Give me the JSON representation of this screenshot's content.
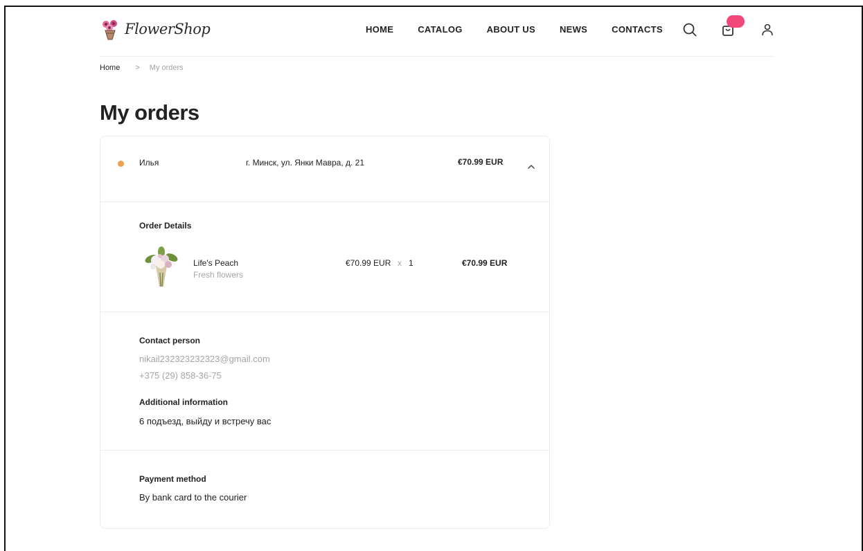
{
  "brand": {
    "name": "FlowerShop"
  },
  "nav": {
    "items": [
      {
        "label": "HOME"
      },
      {
        "label": "CATALOG"
      },
      {
        "label": "ABOUT US"
      },
      {
        "label": "NEWS"
      },
      {
        "label": "CONTACTS"
      }
    ]
  },
  "icons": {
    "search": "search-icon",
    "cart": "shopping-bag-icon",
    "user": "user-icon",
    "collapse": "chevron-up-icon"
  },
  "colors": {
    "status_dot": "#f0a050",
    "cart_badge": "#f0487a"
  },
  "breadcrumb": {
    "home": "Home",
    "separator": ">",
    "current": "My orders"
  },
  "page": {
    "title": "My orders"
  },
  "order": {
    "customer_name": "Илья",
    "address": "г. Минск, ул. Янки Мавра, д. 21",
    "total": "€70.99 EUR",
    "details": {
      "label": "Order Details",
      "items": [
        {
          "name": "Life's Peach",
          "category": "Fresh flowers",
          "price": "€70.99 EUR",
          "times": "x",
          "quantity": "1",
          "line_total": "€70.99 EUR"
        }
      ]
    },
    "contact": {
      "label": "Contact person",
      "email": "nikail232323232323@gmail.com",
      "phone": "+375 (29) 858-36-75"
    },
    "additional": {
      "label": "Additional information",
      "text": "6 подъезд, выйду и встречу вас"
    },
    "payment": {
      "label": "Payment method",
      "value": "By bank card to the courier"
    }
  }
}
